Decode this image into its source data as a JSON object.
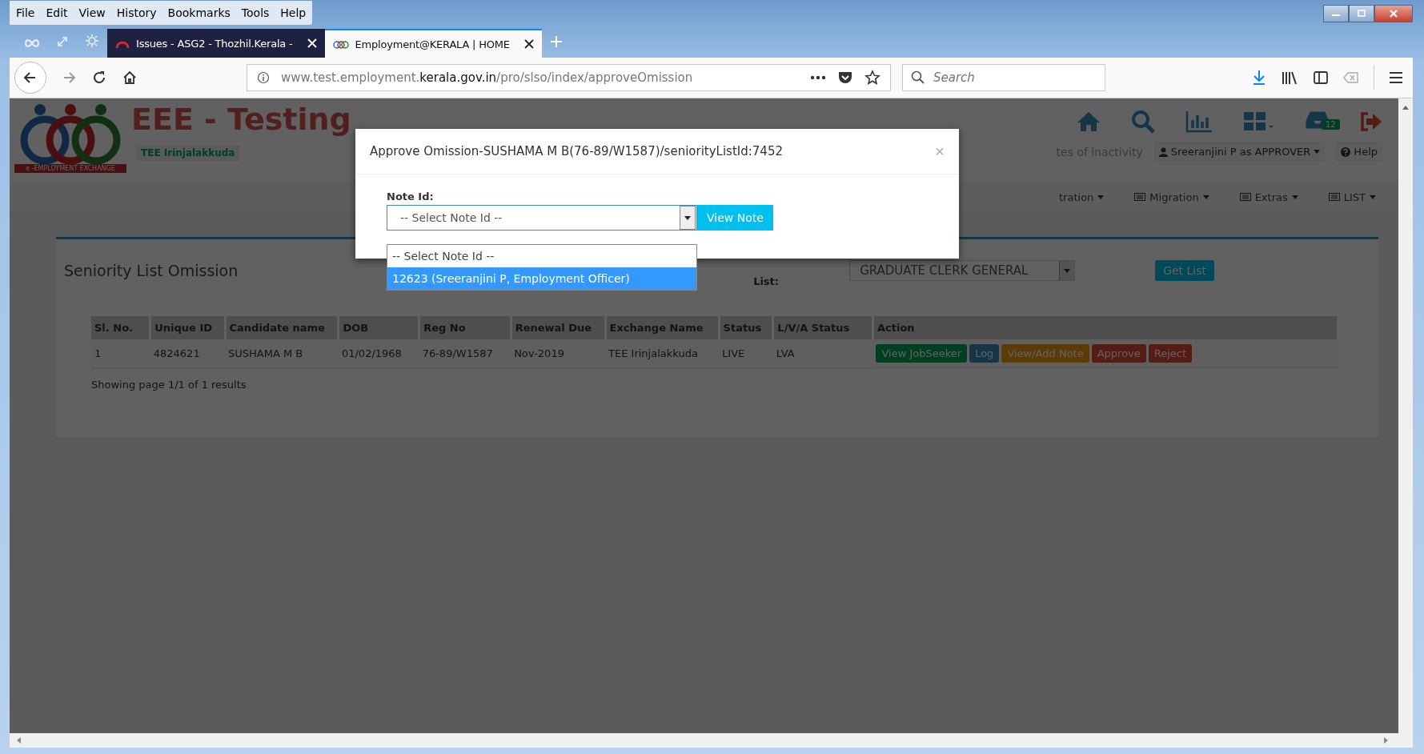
{
  "window": {
    "menu": [
      "File",
      "Edit",
      "View",
      "History",
      "Bookmarks",
      "Tools",
      "Help"
    ]
  },
  "tabs": [
    {
      "title": "Issues - ASG2 - Thozhil.Kerala -",
      "selected": false
    },
    {
      "title": "Employment@KERALA | HOME",
      "selected": true
    }
  ],
  "toolbar": {
    "url_host": "www.test.employment.",
    "url_domain": "kerala.gov.in",
    "url_path": "/pro/slso/index/approveOmission",
    "search_placeholder": "Search"
  },
  "site_header": {
    "title": "EEE - Testing",
    "office": "TEE Irinjalakkuda",
    "logo_caption": "e -EMPLOYMENT EXCHANGE",
    "inbox_count": "12",
    "session_note": "tes of inactivity",
    "user_menu": "Sreeranjini P as APPROVER",
    "help": "Help",
    "nav": [
      "tration",
      "Migration",
      "Extras",
      "LIST"
    ]
  },
  "panel": {
    "title": "Seniority List Omission",
    "list_label": "List:",
    "list_value": "GRADUATE CLERK GENERAL",
    "get_list": "Get List"
  },
  "table": {
    "columns": [
      "Sl. No.",
      "Unique ID",
      "Candidate name",
      "DOB",
      "Reg No",
      "Renewal Due",
      "Exchange Name",
      "Status",
      "L/V/A Status",
      "Action"
    ],
    "rows": [
      {
        "cells": [
          "1",
          "4824621",
          "SUSHAMA M B",
          "01/02/1968",
          "76-89/W1587",
          "Nov-2019",
          "TEE Irinjalakkuda",
          "LIVE",
          "LVA"
        ],
        "actions": [
          {
            "label": "View JobSeeker",
            "kind": "success"
          },
          {
            "label": "Log",
            "kind": "primary"
          },
          {
            "label": "View/Add Note",
            "kind": "warning"
          },
          {
            "label": "Approve",
            "kind": "danger"
          },
          {
            "label": "Reject",
            "kind": "danger"
          }
        ]
      }
    ],
    "footer": "Showing page 1/1 of 1 results"
  },
  "modal": {
    "title": "Approve Omission-SUSHAMA M B(76-89/W1587)/seniorityListId:7452",
    "close": "×",
    "field_label": "Note Id:",
    "field_value": "-- Select Note Id --",
    "view_button": "View Note",
    "options": [
      {
        "label": "-- Select Note Id --",
        "selected": false
      },
      {
        "label": "12623 (Sreeranjini P, Employment Officer)",
        "selected": true
      }
    ]
  }
}
